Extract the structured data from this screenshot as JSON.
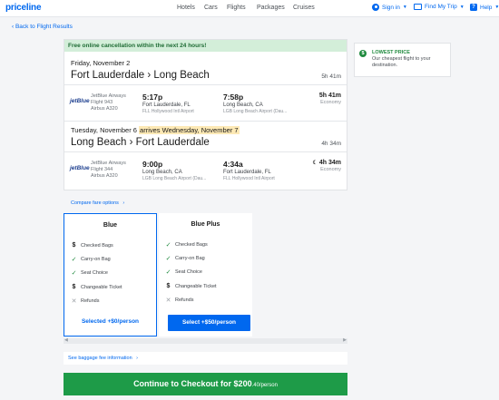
{
  "header": {
    "logo": "priceline",
    "nav": [
      "Hotels",
      "Cars",
      "Flights",
      "Packages",
      "Cruises"
    ],
    "sign_in": "Sign in",
    "find_trip": "Find My Trip",
    "help": "Help"
  },
  "back_link": "‹ Back to Flight Results",
  "banner": "Free online cancellation within the next 24 hours!",
  "outbound": {
    "date": "Friday, November 2",
    "route": "Fort Lauderdale › Long Beach",
    "duration": "5h 41m",
    "airline_logo": "jetBlue",
    "airline": "JetBlue Airways",
    "flight": "Flight 943",
    "aircraft": "Airbus A320",
    "depart_time": "5:17p",
    "depart_city": "Fort Lauderdale, FL",
    "depart_airport": "FLL Hollywood Intl Airport",
    "arrive_time": "7:58p",
    "arrive_city": "Long Beach, CA",
    "arrive_airport": "LGB Long Beach Airport (Dau...",
    "seg_duration": "5h 41m",
    "cabin": "Economy"
  },
  "return": {
    "date": "Tuesday, November 6",
    "arrives_note": "arrives Wednesday, November 7",
    "route": "Long Beach › Fort Lauderdale",
    "duration": "4h 34m",
    "airline_logo": "jetBlue",
    "airline": "JetBlue Airways",
    "flight": "Flight 344",
    "aircraft": "Airbus A320",
    "depart_time": "9:00p",
    "depart_city": "Long Beach, CA",
    "depart_airport": "LGB Long Beach Airport (Dau...",
    "arrive_time": "4:34a",
    "arrive_city": "Fort Lauderdale, FL",
    "arrive_airport": "FLL Hollywood Intl Airport",
    "seg_duration": "4h 34m",
    "cabin": "Economy"
  },
  "side": {
    "title": "LOWEST PRICE",
    "text": "Our cheapest flight to your destination."
  },
  "compare_link": "Compare fare options",
  "fares": [
    {
      "title": "Blue",
      "features": [
        {
          "icon": "dollar-icon",
          "label": "Checked Bags"
        },
        {
          "icon": "check-icon",
          "label": "Carry-on Bag"
        },
        {
          "icon": "check-icon",
          "label": "Seat Choice"
        },
        {
          "icon": "dollar-icon",
          "label": "Changeable Ticket"
        },
        {
          "icon": "x-icon",
          "label": "Refunds"
        }
      ],
      "action": "Selected +$0/person"
    },
    {
      "title": "Blue Plus",
      "features": [
        {
          "icon": "check-icon",
          "label": "Checked Bags"
        },
        {
          "icon": "check-icon",
          "label": "Carry-on Bag"
        },
        {
          "icon": "check-icon",
          "label": "Seat Choice"
        },
        {
          "icon": "dollar-icon",
          "label": "Changeable Ticket"
        },
        {
          "icon": "x-icon",
          "label": "Refunds"
        }
      ],
      "action": "Select +$50/person"
    }
  ],
  "baggage_link": "See baggage fee information",
  "checkout": {
    "label": "Continue to Checkout for $200",
    "cents": ".40/person"
  },
  "colors": {
    "brand": "#0068ef",
    "checkout": "#1e9b48",
    "banner_bg": "#d3eed9"
  }
}
